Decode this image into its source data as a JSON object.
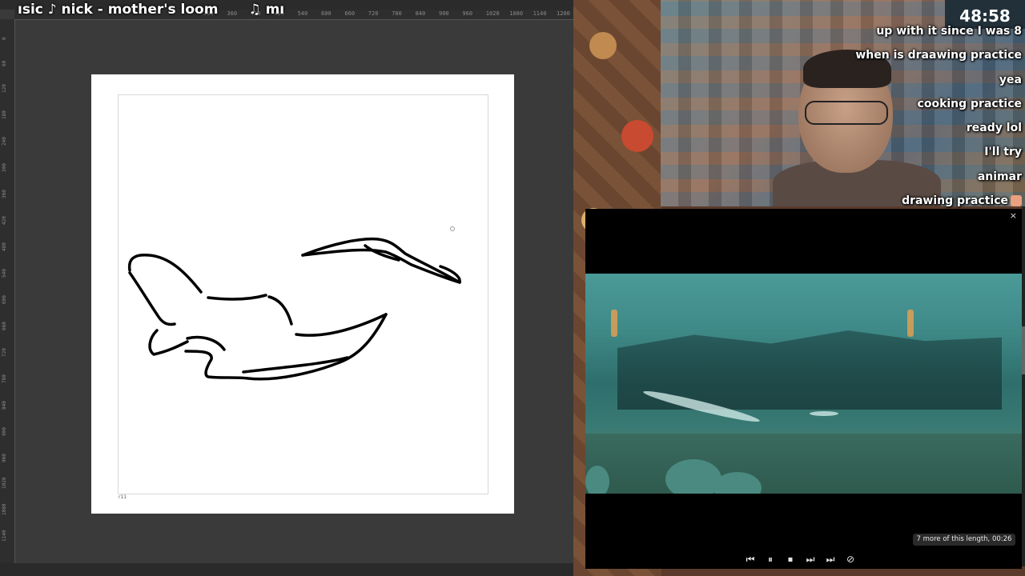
{
  "music_ticker": {
    "left": "ısic ♪ nick - mother's loom",
    "right": "♫ mı"
  },
  "ruler_top_ticks": [
    "300",
    "360",
    "420",
    "480",
    "540",
    "600",
    "660",
    "720",
    "780",
    "840",
    "900",
    "960",
    "1020",
    "1080",
    "1140",
    "1200",
    "1260"
  ],
  "ruler_left_ticks": [
    "0",
    "60",
    "120",
    "180",
    "240",
    "300",
    "360",
    "420",
    "480",
    "540",
    "600",
    "660",
    "720",
    "780",
    "840",
    "900",
    "960",
    "1020",
    "1080",
    "1140"
  ],
  "canvas": {
    "corner_label": "r11"
  },
  "timer": "48:58",
  "chat": [
    {
      "text": "up with it since I was 8"
    },
    {
      "text": "when is draawing practice"
    },
    {
      "text": "yea"
    },
    {
      "text": "cooking practice"
    },
    {
      "text": "ready lol"
    },
    {
      "text": "I'll try"
    },
    {
      "text": "animar"
    },
    {
      "text": "drawing practice",
      "emote": "pig-emote"
    }
  ],
  "player": {
    "close_icon": "×",
    "info": "7 more of this length, 00:26",
    "controls": [
      {
        "name": "rewind-icon",
        "glyph": "⏮"
      },
      {
        "name": "pause-icon",
        "glyph": "⏸"
      },
      {
        "name": "stop-icon",
        "glyph": "⏹"
      },
      {
        "name": "forward-icon",
        "glyph": "⏭"
      },
      {
        "name": "skip-end-icon",
        "glyph": "⏭"
      },
      {
        "name": "hide-icon",
        "glyph": "⊘"
      }
    ]
  },
  "colors": {
    "canvas_bg": "#3a3a3a",
    "paper": "#ffffff",
    "video_water": "#3f8a88",
    "timer_bg": "#22303a"
  }
}
